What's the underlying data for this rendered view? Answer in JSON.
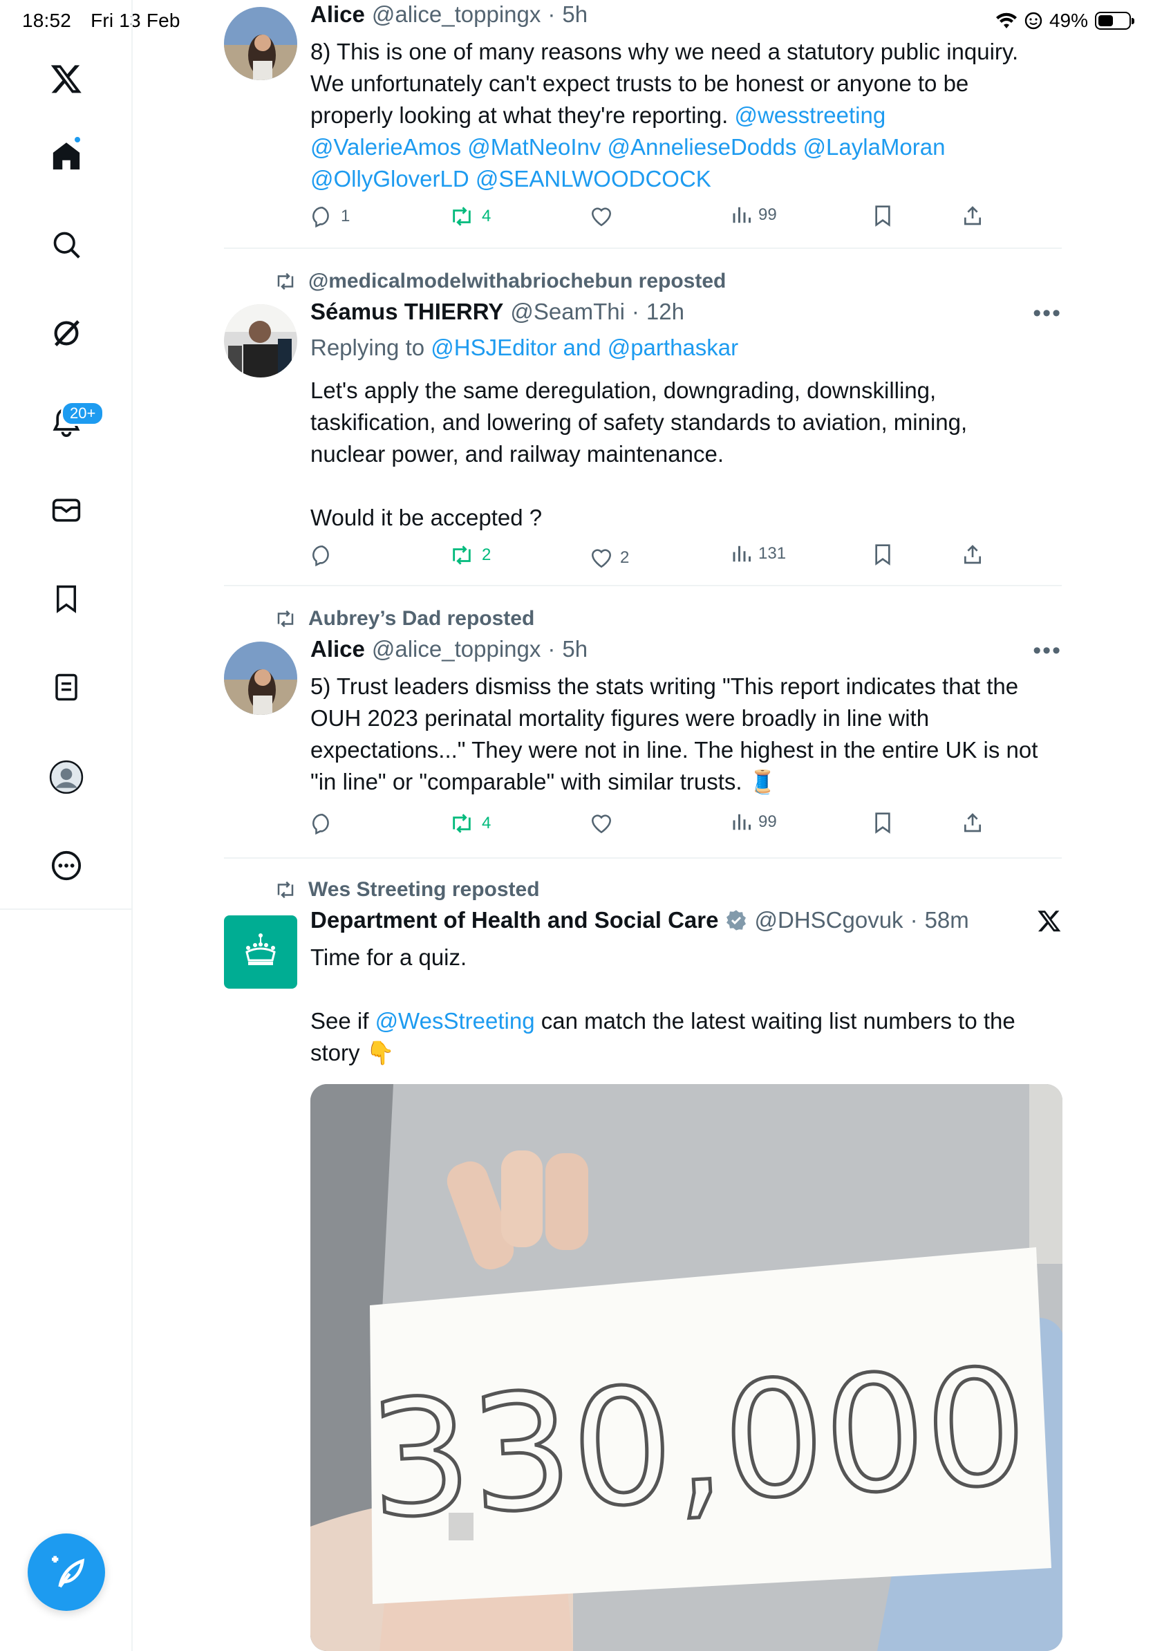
{
  "status_bar": {
    "time": "18:52",
    "date": "Fri 13 Feb",
    "battery": "49%",
    "battery_level": 0.49
  },
  "sidebar": {
    "items": [
      {
        "name": "x-logo",
        "icon": "x-logo-icon"
      },
      {
        "name": "home",
        "icon": "home-icon",
        "has_dot": true
      },
      {
        "name": "explore",
        "icon": "search-icon"
      },
      {
        "name": "grok",
        "icon": "grok-icon"
      },
      {
        "name": "notifications",
        "icon": "bell-icon",
        "badge": "20+"
      },
      {
        "name": "messages",
        "icon": "mail-icon"
      },
      {
        "name": "bookmarks",
        "icon": "bookmark-icon"
      },
      {
        "name": "lists",
        "icon": "list-icon"
      },
      {
        "name": "profile",
        "icon": "avatar-icon"
      },
      {
        "name": "more",
        "icon": "more-icon"
      }
    ],
    "compose_icon": "compose-icon"
  },
  "tweets": [
    {
      "name": "Alice",
      "handle": "@alice_toppingx",
      "time": "5h",
      "body": {
        "line1": "8) This is one of many reasons why we need a statutory public inquiry.",
        "line2": "We unfortunately can't expect trusts to be honest or anyone to be",
        "line3_text": "properly looking at what they're reporting. ",
        "mention1": "@wesstreeting",
        "mentions_line4": "@ValerieAmos @MatNeoInv @AnnelieseDodds @LaylaMoran",
        "mentions_line5": "@OllyGloverLD @SEANLWOODCOCK"
      },
      "replies": "1",
      "reposts": "4",
      "likes": "",
      "views": "99"
    },
    {
      "repost_by": "@medicalmodelwithabriochebun reposted",
      "name": "Séamus THIERRY",
      "handle": "@SeamThi",
      "time": "12h",
      "replying_label": "Replying to ",
      "replying_to": "@HSJEditor and @parthaskar",
      "body": {
        "line1": "Let's apply the same deregulation, downgrading, downskilling,",
        "line2": "taskification, and lowering of safety standards to aviation, mining,",
        "line3": "nuclear power, and railway maintenance.",
        "line4": "Would it be accepted ?"
      },
      "replies": "",
      "reposts": "2",
      "likes": "2",
      "views": "131"
    },
    {
      "repost_by": "Aubrey’s Dad reposted",
      "name": "Alice",
      "handle": "@alice_toppingx",
      "time": "5h",
      "body": {
        "line1": "5) Trust leaders dismiss the stats writing \"This report indicates that the",
        "line2": "OUH 2023 perinatal mortality figures were broadly in line with",
        "line3": "expectations...\" They were not in line. The highest in the entire UK is not",
        "line4": "\"in line\" or \"comparable\" with similar trusts. 🧵"
      },
      "replies": "",
      "reposts": "4",
      "likes": "",
      "views": "99"
    },
    {
      "repost_by": "Wes Streeting reposted",
      "name": "Department of Health and Social Care",
      "verified_icon": "verified-gov-badge-icon",
      "handle": "@DHSCgovuk",
      "time": "58m",
      "body": {
        "line1": "Time for a quiz.",
        "line2_pre": "See if ",
        "line2_mention": "@WesStreeting",
        "line2_post": " can match the latest waiting list numbers to the",
        "line3": "story 👇"
      },
      "media": {
        "sign_text": "330,000"
      }
    }
  ],
  "colors": {
    "accent": "#1d9bf0",
    "repost_green": "#00ba7c",
    "muted": "#536471",
    "dhsc_green": "#00ad93"
  }
}
